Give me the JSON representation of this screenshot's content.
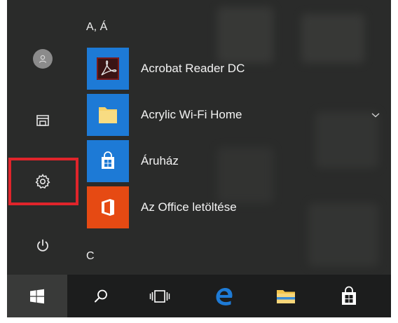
{
  "start_menu": {
    "rail": {
      "items": [
        {
          "name": "user-account",
          "icon": "user-avatar-icon"
        },
        {
          "name": "documents",
          "icon": "documents-icon"
        },
        {
          "name": "settings",
          "icon": "gear-icon",
          "highlighted": true
        },
        {
          "name": "power",
          "icon": "power-icon"
        }
      ]
    },
    "app_list": {
      "section_a_header": "A, Á",
      "section_c_header": "C",
      "apps": [
        {
          "label": "Acrobat Reader DC",
          "icon": "acrobat-reader-icon",
          "tile_color": "#1d7ad6"
        },
        {
          "label": "Acrylic Wi-Fi Home",
          "icon": "folder-icon",
          "tile_color": "#1d7ad6",
          "expandable": true
        },
        {
          "label": "Áruház",
          "icon": "store-icon",
          "tile_color": "#1d7ad6"
        },
        {
          "label": "Az Office letöltése",
          "icon": "office-icon",
          "tile_color": "#e64a13"
        }
      ]
    }
  },
  "taskbar": {
    "items": [
      {
        "name": "start",
        "icon": "windows-logo-icon"
      },
      {
        "name": "search",
        "icon": "search-icon"
      },
      {
        "name": "task-view",
        "icon": "task-view-icon"
      },
      {
        "name": "edge",
        "icon": "edge-browser-icon"
      },
      {
        "name": "file-explorer",
        "icon": "file-explorer-icon"
      },
      {
        "name": "store",
        "icon": "store-bag-icon"
      }
    ]
  },
  "colors": {
    "menu_bg": "#2a2b2a",
    "taskbar_bg": "#1c1d1d",
    "highlight": "#e0242b",
    "accent_blue": "#1d7ad6",
    "office_orange": "#e64a13",
    "edge_blue": "#1e7bd6"
  }
}
